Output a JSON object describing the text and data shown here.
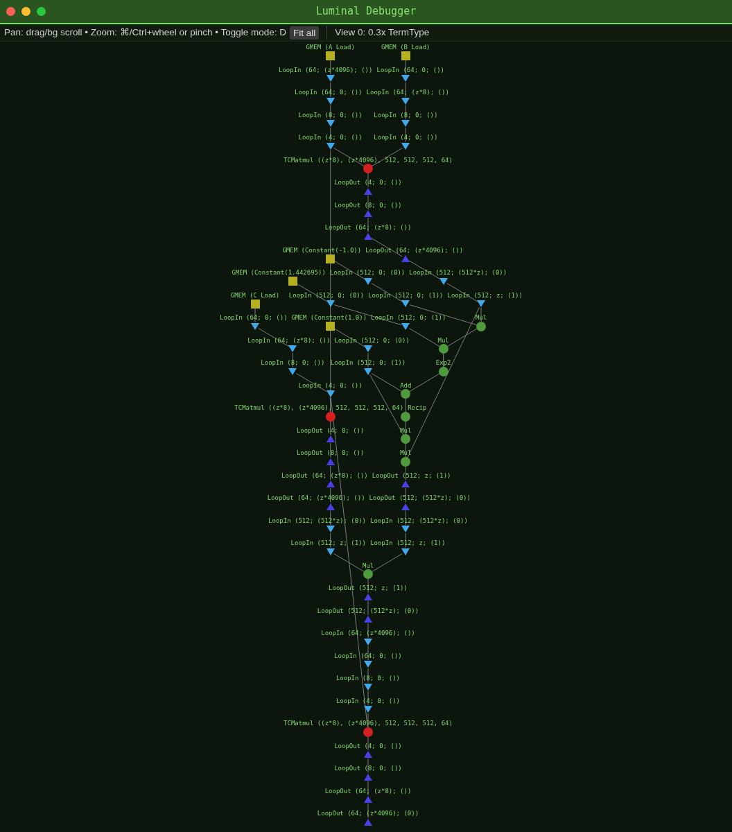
{
  "window": {
    "title": "Luminal Debugger"
  },
  "toolbar": {
    "hint": "Pan: drag/bg scroll • Zoom: ⌘/Ctrl+wheel or pinch • Toggle mode: D",
    "fit_button": "Fit all",
    "view_label": "View 0: 0.3x TermType"
  },
  "graph": {
    "layers": [
      [
        {
          "kind": "gmem",
          "label": "GMEM (A Load)"
        },
        {
          "kind": "gmem",
          "label": "GMEM (B Load)"
        }
      ],
      [
        {
          "kind": "loop_in",
          "label": "LoopIn (64; (z*4096); ())"
        },
        {
          "kind": "loop_in",
          "label": "LoopIn (64; 0; ())"
        }
      ],
      [
        {
          "kind": "loop_in",
          "label": "LoopIn (64; 0; ())"
        },
        {
          "kind": "loop_in",
          "label": "LoopIn (64; (z*8); ())"
        }
      ],
      [
        {
          "kind": "loop_in",
          "label": "LoopIn (8; 0; ())"
        },
        {
          "kind": "loop_in",
          "label": "LoopIn (8; 0; ())"
        }
      ],
      [
        {
          "kind": "loop_in",
          "label": "LoopIn (4; 0; ())"
        },
        {
          "kind": "loop_in",
          "label": "LoopIn (4; 0; ())"
        }
      ],
      [
        {
          "kind": "matmul",
          "label": "TCMatmul ((z*8), (z*4096), 512, 512, 512, 64)"
        }
      ],
      [
        {
          "kind": "loop_out",
          "label": "LoopOut (4; 0; ())"
        }
      ],
      [
        {
          "kind": "loop_out",
          "label": "LoopOut (8; 0; ())"
        }
      ],
      [
        {
          "kind": "loop_out",
          "label": "LoopOut (64; (z*8); ())"
        }
      ],
      [
        {
          "kind": "gmem",
          "label": "GMEM (Constant(-1.0))"
        },
        {
          "kind": "loop_out",
          "label": "LoopOut (64; (z*4096); ())"
        }
      ],
      [
        {
          "kind": "gmem",
          "label": "GMEM (Constant(1.442695))"
        },
        {
          "kind": "loop_in",
          "label": "LoopIn (512; 0; (0))"
        },
        {
          "kind": "loop_in",
          "label": "LoopIn (512; (512*z); (0))"
        }
      ],
      [
        {
          "kind": "gmem",
          "label": "GMEM (C Load)"
        },
        {
          "kind": "loop_in",
          "label": "LoopIn (512; 0; (0))"
        },
        {
          "kind": "loop_in",
          "label": "LoopIn (512; 0; (1))"
        },
        {
          "kind": "loop_in",
          "label": "LoopIn (512; z; (1))"
        }
      ],
      [
        {
          "kind": "loop_in",
          "label": "LoopIn (64; 0; ())"
        },
        {
          "kind": "gmem",
          "label": "GMEM (Constant(1.0))"
        },
        {
          "kind": "loop_in",
          "label": "LoopIn (512; 0; (1))"
        },
        {
          "kind": "op",
          "label": "Mul"
        }
      ],
      [
        {
          "kind": "loop_in",
          "label": "LoopIn (64; (z*8); ())"
        },
        {
          "kind": "loop_in",
          "label": "LoopIn (512; 0; (0))"
        },
        {
          "kind": "op",
          "label": "Mul"
        }
      ],
      [
        {
          "kind": "loop_in",
          "label": "LoopIn (8; 0; ())"
        },
        {
          "kind": "loop_in",
          "label": "LoopIn (512; 0; (1))"
        },
        {
          "kind": "op",
          "label": "Exp2"
        }
      ],
      [
        {
          "kind": "loop_in",
          "label": "LoopIn (4; 0; ())"
        },
        {
          "kind": "op",
          "label": "Add"
        }
      ],
      [
        {
          "kind": "matmul",
          "label": "TCMatmul ((z*8), (z*4096), 512, 512, 512, 64)"
        },
        {
          "kind": "op",
          "label": "Recip"
        }
      ],
      [
        {
          "kind": "loop_out",
          "label": "LoopOut (4; 0; ())"
        },
        {
          "kind": "op",
          "label": "Mul"
        }
      ],
      [
        {
          "kind": "loop_out",
          "label": "LoopOut (8; 0; ())"
        },
        {
          "kind": "op",
          "label": "Mul"
        }
      ],
      [
        {
          "kind": "loop_out",
          "label": "LoopOut (64; (z*8); ())"
        },
        {
          "kind": "loop_out",
          "label": "LoopOut (512; z; (1))"
        }
      ],
      [
        {
          "kind": "loop_out",
          "label": "LoopOut (64; (z*4096); ())"
        },
        {
          "kind": "loop_out",
          "label": "LoopOut (512; (512*z); (0))"
        }
      ],
      [
        {
          "kind": "loop_in",
          "label": "LoopIn (512; (512*z); (0))"
        },
        {
          "kind": "loop_in",
          "label": "LoopIn (512; (512*z); (0))"
        }
      ],
      [
        {
          "kind": "loop_in",
          "label": "LoopIn (512; z; (1))"
        },
        {
          "kind": "loop_in",
          "label": "LoopIn (512; z; (1))"
        }
      ],
      [
        {
          "kind": "op",
          "label": "Mul"
        }
      ],
      [
        {
          "kind": "loop_out",
          "label": "LoopOut (512; z; (1))"
        }
      ],
      [
        {
          "kind": "loop_out",
          "label": "LoopOut (512; (512*z); (0))"
        }
      ],
      [
        {
          "kind": "loop_in",
          "label": "LoopIn (64; (z*4096); ())"
        }
      ],
      [
        {
          "kind": "loop_in",
          "label": "LoopIn (64; 0; ())"
        }
      ],
      [
        {
          "kind": "loop_in",
          "label": "LoopIn (8; 0; ())"
        }
      ],
      [
        {
          "kind": "loop_in",
          "label": "LoopIn (4; 0; ())"
        }
      ],
      [
        {
          "kind": "matmul",
          "label": "TCMatmul ((z*8), (z*4096), 512, 512, 512, 64)"
        }
      ],
      [
        {
          "kind": "loop_out",
          "label": "LoopOut (4; 0; ())"
        }
      ],
      [
        {
          "kind": "loop_out",
          "label": "LoopOut (8; 0; ())"
        }
      ],
      [
        {
          "kind": "loop_out",
          "label": "LoopOut (64; (z*8); ())"
        }
      ],
      [
        {
          "kind": "loop_out",
          "label": "LoopOut (64; (z*4096); (0))"
        }
      ]
    ]
  }
}
